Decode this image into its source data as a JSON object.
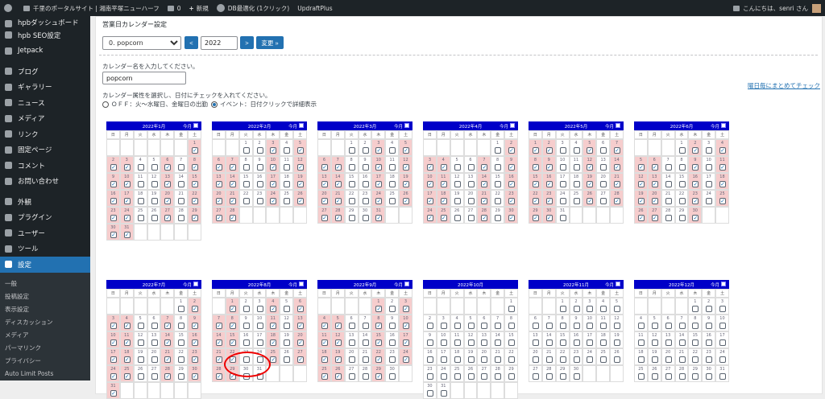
{
  "adminbar": {
    "site_name": "千里のポータルサイト | 湘南平塚ニューハーフ",
    "comments_count": "0",
    "new_label": "新規",
    "db_plugin": "DB最適化 (1クリック)",
    "updraft": "UpdraftPlus",
    "greeting": "こんにちは、senri さん"
  },
  "sidebar": {
    "items": [
      {
        "label": "hpbダッシュボード",
        "icon": "hpb-icon"
      },
      {
        "label": "hpb SEO設定",
        "icon": "seo-icon"
      },
      {
        "label": "Jetpack",
        "icon": "jetpack-icon"
      },
      {
        "label": "ブログ",
        "icon": "pin-icon"
      },
      {
        "label": "ギャラリー",
        "icon": "pin-icon"
      },
      {
        "label": "ニュース",
        "icon": "megaphone-icon"
      },
      {
        "label": "メディア",
        "icon": "media-icon"
      },
      {
        "label": "リンク",
        "icon": "link-icon"
      },
      {
        "label": "固定ページ",
        "icon": "page-icon"
      },
      {
        "label": "コメント",
        "icon": "comment-icon"
      },
      {
        "label": "お問い合わせ",
        "icon": "mail-icon"
      },
      {
        "label": "外観",
        "icon": "brush-icon"
      },
      {
        "label": "プラグイン",
        "icon": "plugin-icon"
      },
      {
        "label": "ユーザー",
        "icon": "user-icon"
      },
      {
        "label": "ツール",
        "icon": "wrench-icon"
      },
      {
        "label": "設定",
        "icon": "settings-icon"
      }
    ],
    "submenu": [
      "一般",
      "投稿設定",
      "表示設定",
      "ディスカッション",
      "メディア",
      "パーマリンク",
      "プライバシー",
      "Auto Limit Posts"
    ]
  },
  "page": {
    "title": "営業日カレンダー設定",
    "calendar_select": "0. popcorn",
    "prev": "<",
    "year": "2022",
    "next": ">",
    "change": "変更 »",
    "name_label": "カレンダー名を入力してください。",
    "name_value": "popcorn",
    "attr_label": "カレンダー属性を選択し、日付にチェックを入れてください。",
    "opt_off": "ＯＦＦ：火〜水曜日、金曜日の出勤",
    "opt_event": "イベント：日付クリックで詳細表示",
    "weekday_link": "曜日毎にまとめてチェック"
  },
  "weekday_labels": [
    "日",
    "月",
    "火",
    "水",
    "木",
    "金",
    "土"
  ],
  "today_label": "今月",
  "months": [
    {
      "title": "2022年1月",
      "offset": 6,
      "days": 31
    },
    {
      "title": "2022年2月",
      "offset": 2,
      "days": 28
    },
    {
      "title": "2022年3月",
      "offset": 2,
      "days": 31
    },
    {
      "title": "2022年4月",
      "offset": 5,
      "days": 30
    },
    {
      "title": "2022年5月",
      "offset": 0,
      "days": 31
    },
    {
      "title": "2022年6月",
      "offset": 3,
      "days": 30
    },
    {
      "title": "2022年7月",
      "offset": 5,
      "days": 31
    },
    {
      "title": "2022年8月",
      "offset": 1,
      "days": 31
    },
    {
      "title": "2022年9月",
      "offset": 4,
      "days": 30
    },
    {
      "title": "2022年10月",
      "offset": 6,
      "days": 31
    },
    {
      "title": "2022年11月",
      "offset": 2,
      "days": 30
    },
    {
      "title": "2022年12月",
      "offset": 4,
      "days": 31
    }
  ],
  "off_weekdays": [
    2,
    3,
    5
  ],
  "event_marked_months": [
    0,
    1,
    2,
    3,
    4,
    5,
    6,
    7,
    8
  ],
  "colors": {
    "header": "#0000c8",
    "red": "#f6cdcd",
    "accent": "#2271b1"
  }
}
